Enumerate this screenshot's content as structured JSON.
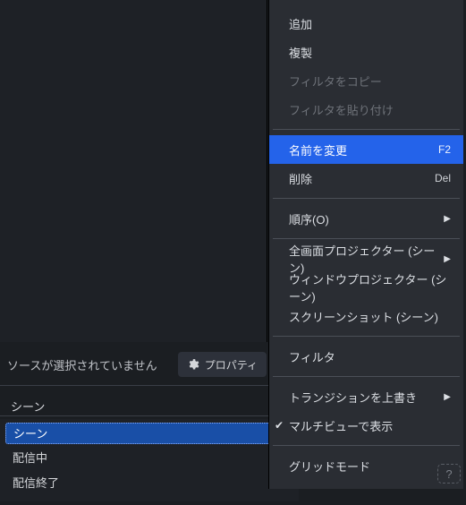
{
  "preview": {
    "no_source_selected": "ソースが選択されていません",
    "properties_button": "プロパティ"
  },
  "panel": {
    "title": "シーン",
    "items": [
      {
        "label": "シーン",
        "selected": true
      },
      {
        "label": "配信中",
        "selected": false
      },
      {
        "label": "配信終了",
        "selected": false
      }
    ]
  },
  "context_menu": {
    "add": "追加",
    "duplicate": "複製",
    "copy_filters": "フィルタをコピー",
    "paste_filters": "フィルタを貼り付け",
    "rename": "名前を変更",
    "rename_shortcut": "F2",
    "delete": "削除",
    "delete_shortcut": "Del",
    "order": "順序(O)",
    "fullscreen_proj": "全画面プロジェクター (シーン)",
    "window_proj": "ウィンドウプロジェクター (シーン)",
    "screenshot": "スクリーンショット (シーン)",
    "filters": "フィルタ",
    "transition_overwrite": "トランジションを上書き",
    "multiview_show": "マルチビューで表示",
    "grid_mode": "グリッドモード"
  },
  "help_badge": "?"
}
